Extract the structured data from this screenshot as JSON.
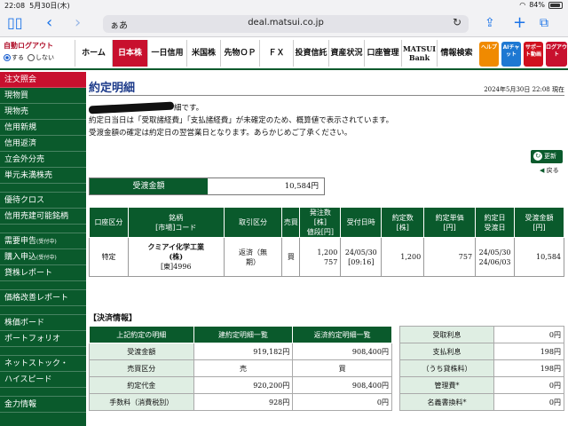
{
  "status_bar": {
    "time": "22:08",
    "date": "5月30日(木)",
    "battery": "84%"
  },
  "browser": {
    "text_size_label": "ぁあ",
    "url": "deal.matsui.co.jp"
  },
  "auto_logout": {
    "title": "自動ログアウト",
    "on_label": "する",
    "off_label": "しない"
  },
  "nav": {
    "tabs": [
      "ホーム",
      "日本株",
      "一日信用",
      "米国株",
      "先物ＯＰ",
      "ＦＸ",
      "投資信託",
      "資産状況",
      "口座管理",
      "MATSUI Bank",
      "情報検索"
    ],
    "icons": [
      "ヘルプ",
      "AIチャット",
      "サポート動画",
      "ログアウト"
    ],
    "colors": {
      "help": "#f08a00",
      "ai": "#1e78d2",
      "support": "#d0101e",
      "logout": "#c8102e"
    }
  },
  "sidebar": {
    "items": [
      {
        "label": "注文照会",
        "head": true
      },
      {
        "label": "現物買"
      },
      {
        "label": "現物売"
      },
      {
        "label": "信用新規"
      },
      {
        "label": "信用返済"
      },
      {
        "label": "立会外分売"
      },
      {
        "label": "単元未満株売"
      },
      {
        "gap": true
      },
      {
        "label": "優待クロス"
      },
      {
        "label": "信用売建可能銘柄"
      },
      {
        "gap": true
      },
      {
        "label": "需要申告",
        "small": "(受付中)"
      },
      {
        "label": "購入申込",
        "small": "(受付中)"
      },
      {
        "label": "貸株レポート"
      },
      {
        "gap": true
      },
      {
        "label": "価格改善レポート"
      },
      {
        "gap": true
      },
      {
        "label": "株価ボード"
      },
      {
        "label": "ポートフォリオ"
      },
      {
        "gap": true
      },
      {
        "label": "ネットストック・"
      },
      {
        "label": "ハイスピード"
      },
      {
        "gap": true
      },
      {
        "label": "金力情報"
      }
    ]
  },
  "page": {
    "title": "約定明細",
    "datetime": "2024年5月30日 22:08 現在",
    "msg_line1_suffix": "細です。",
    "msg_line2": "約定日当日は「受取諸経費」「支払諸経費」が未確定のため、概算値で表示されています。",
    "msg_line3": "受渡金額の確定は約定日の翌営業日となります。あらかじめご了承ください。",
    "update_label": "更新",
    "back_label": "戻る"
  },
  "amount": {
    "label": "受渡金額",
    "value": "10,584円"
  },
  "order_table": {
    "headers": [
      "口座区分",
      "銘柄\n[市場]コード",
      "取引区分",
      "売買",
      "発注数\n[株]\n値段[円]",
      "受付日時",
      "約定数\n[株]",
      "約定単価\n[円]",
      "約定日\n受渡日",
      "受渡金額\n[円]"
    ],
    "row": {
      "account": "特定",
      "name": "クミアイ化学工業\n(株)",
      "market_code": "[東]4996",
      "trade_type": "返済（無\n期）",
      "side": "買",
      "order_qty": "1,200",
      "order_price": "757",
      "received": "24/05/30\n[09:16]",
      "exec_qty": "1,200",
      "exec_price": "757",
      "exec_date": "24/05/30",
      "settle_date": "24/06/03",
      "amount": "10,584"
    }
  },
  "settlement": {
    "section_title": "【決済情報】",
    "headers": [
      "上記約定の明細",
      "建約定明細一覧",
      "返済約定明細一覧"
    ],
    "rows": [
      {
        "label": "受渡金額",
        "a": "919,182円",
        "b": "908,400円"
      },
      {
        "label": "売買区分",
        "a": "売",
        "b": "買",
        "center": true
      },
      {
        "label": "約定代金",
        "a": "920,200円",
        "b": "908,400円"
      },
      {
        "label": "手数料（消費税別）",
        "a": "928円",
        "b": "0円"
      }
    ],
    "right_rows": [
      {
        "label": "受取利息",
        "value": "0円"
      },
      {
        "label": "支払利息",
        "value": "198円"
      },
      {
        "label": "（うち貸株料）",
        "value": "198円"
      },
      {
        "label": "管理費*",
        "value": "0円"
      },
      {
        "label": "名義書換料*",
        "value": "0円"
      }
    ]
  }
}
